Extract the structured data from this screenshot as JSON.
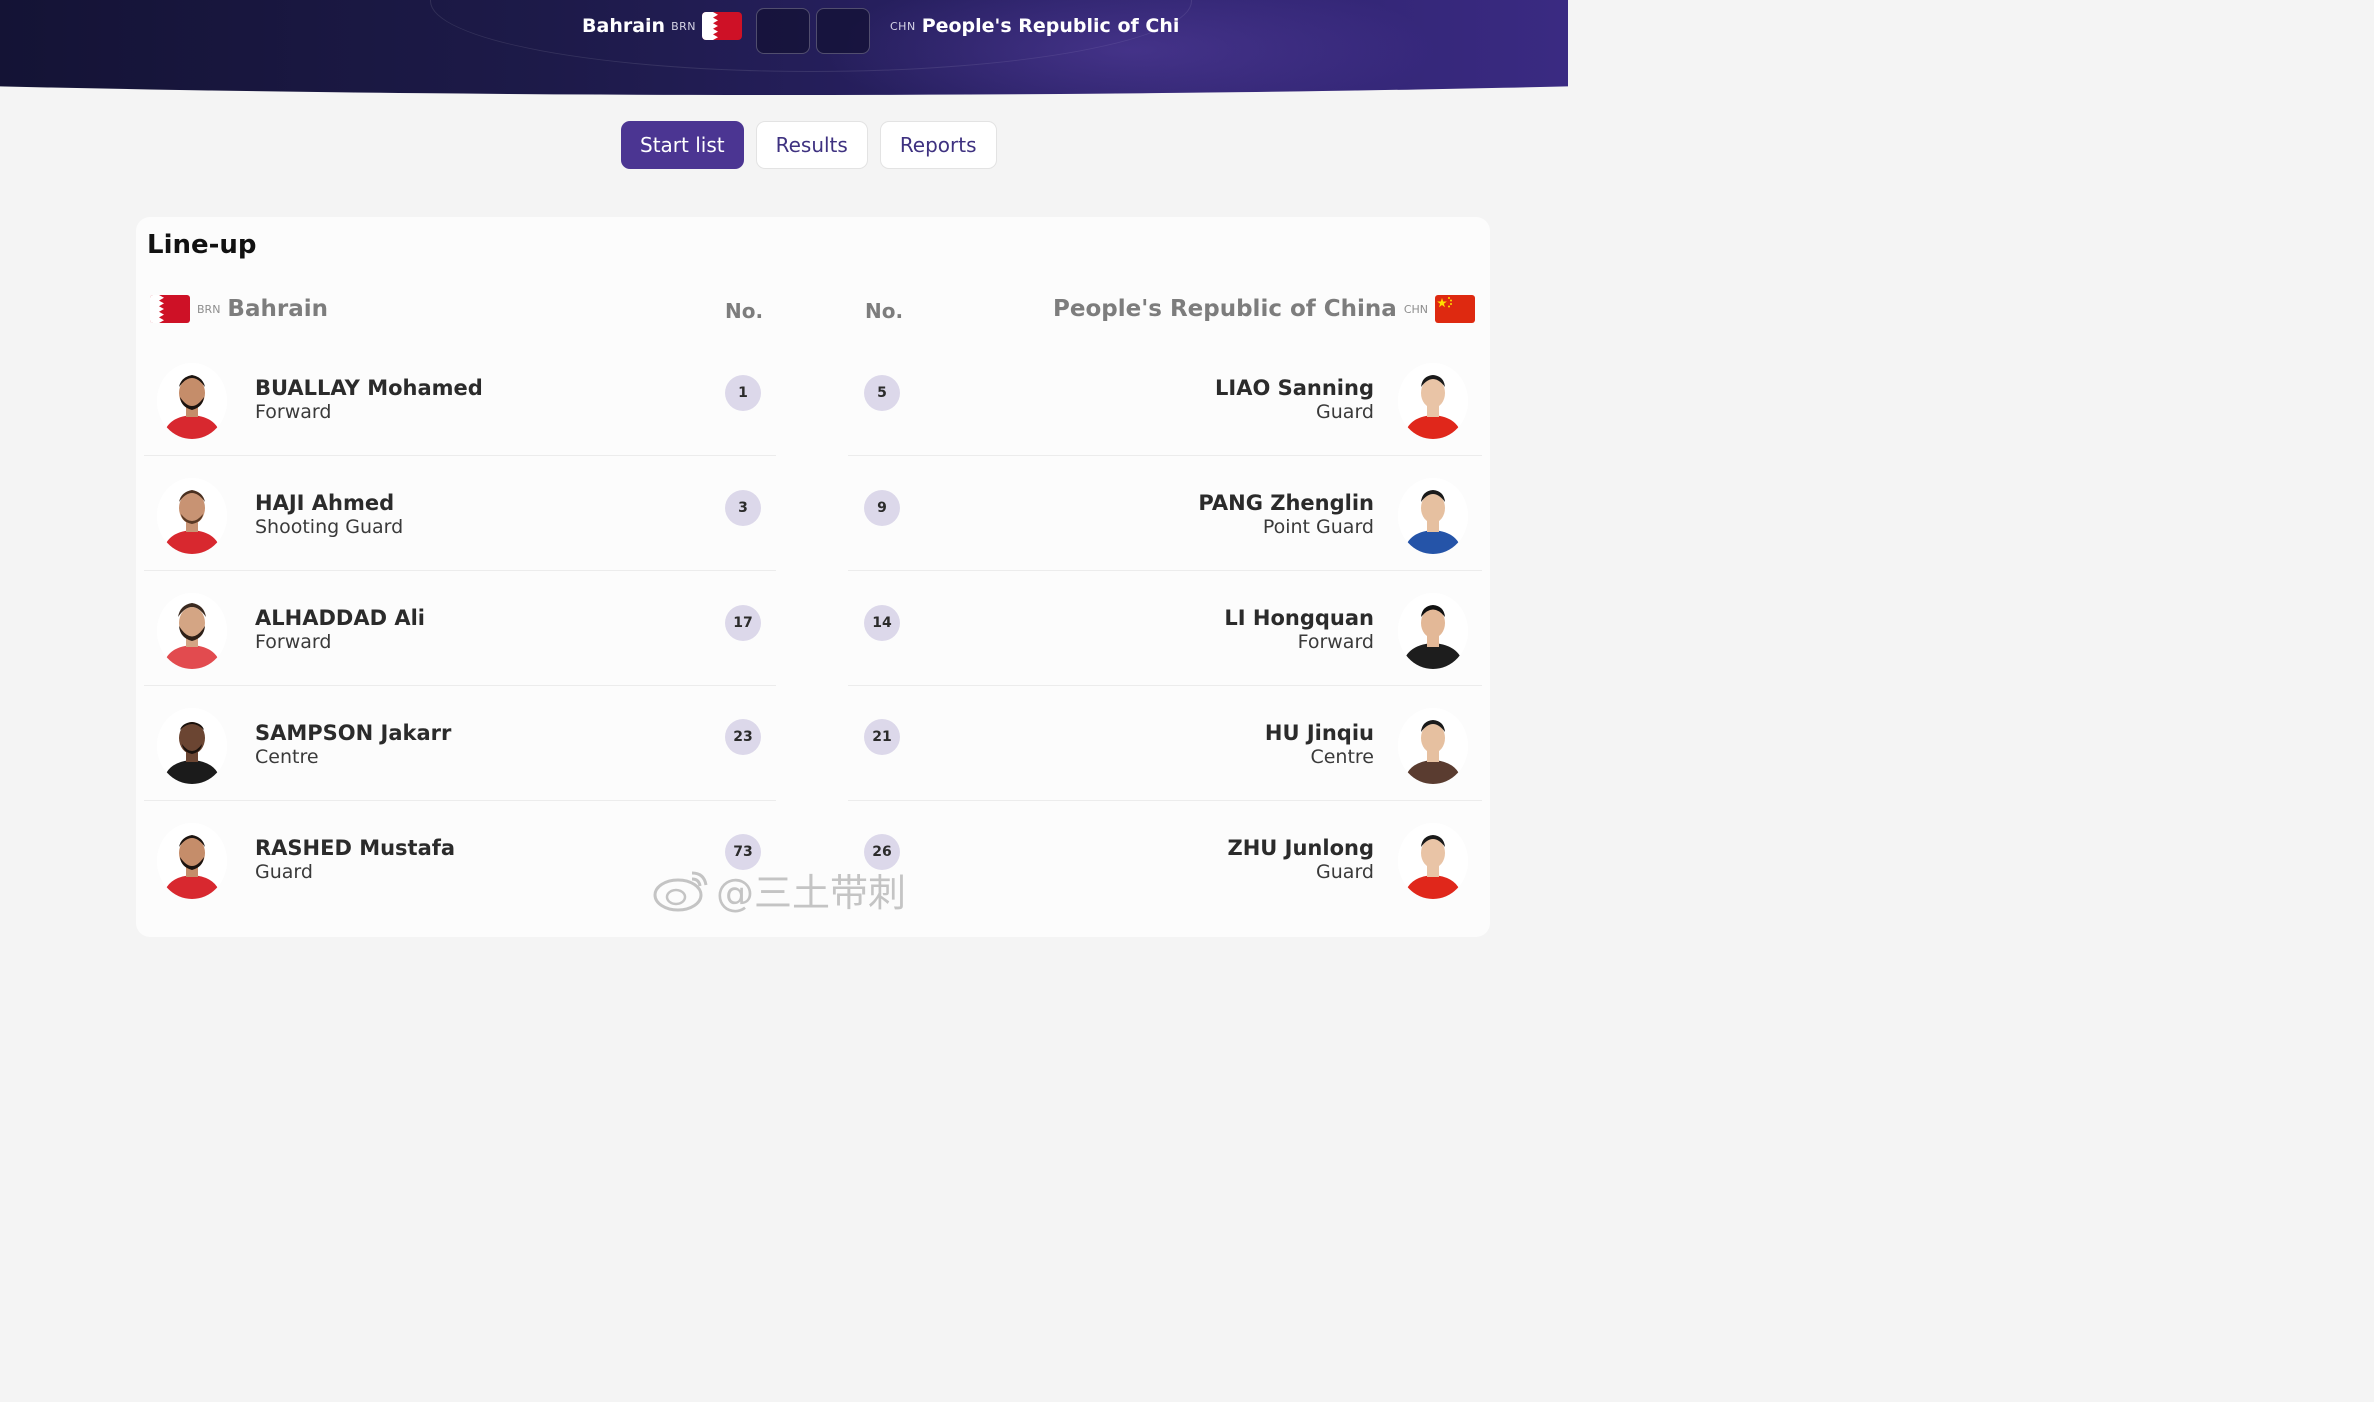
{
  "match": {
    "home": {
      "name": "Bahrain",
      "code": "BRN",
      "flag": "bahrain-flag"
    },
    "away": {
      "name": "People's Republic of China",
      "code": "CHN",
      "flag": "china-flag"
    },
    "home_score": "",
    "away_score": ""
  },
  "tabs": [
    {
      "label": "Start list",
      "active": true
    },
    {
      "label": "Results",
      "active": false
    },
    {
      "label": "Reports",
      "active": false
    }
  ],
  "lineup": {
    "title": "Line-up",
    "no_label": "No.",
    "home_team": {
      "name": "Bahrain",
      "code": "BRN"
    },
    "away_team": {
      "name": "People's Republic of China",
      "code": "CHN"
    },
    "home_players": [
      {
        "name": "BUALLAY Mohamed",
        "position": "Forward",
        "number": "1"
      },
      {
        "name": "HAJI Ahmed",
        "position": "Shooting Guard",
        "number": "3"
      },
      {
        "name": "ALHADDAD Ali",
        "position": "Forward",
        "number": "17"
      },
      {
        "name": "SAMPSON Jakarr",
        "position": "Centre",
        "number": "23"
      },
      {
        "name": "RASHED Mustafa",
        "position": "Guard",
        "number": "73"
      }
    ],
    "away_players": [
      {
        "name": "LIAO Sanning",
        "position": "Guard",
        "number": "5"
      },
      {
        "name": "PANG Zhenglin",
        "position": "Point Guard",
        "number": "9"
      },
      {
        "name": "LI Hongquan",
        "position": "Forward",
        "number": "14"
      },
      {
        "name": "HU Jinqiu",
        "position": "Centre",
        "number": "21"
      },
      {
        "name": "ZHU Junlong",
        "position": "Guard",
        "number": "26"
      }
    ]
  },
  "watermark": {
    "text": "@三土带刺"
  },
  "colors": {
    "header_bg": "#1d1a49",
    "accent": "#4b3592",
    "badge_bg": "#dcd8ea",
    "bahrain_red": "#ce1126",
    "china_red": "#de2910",
    "china_star": "#ffde00"
  }
}
